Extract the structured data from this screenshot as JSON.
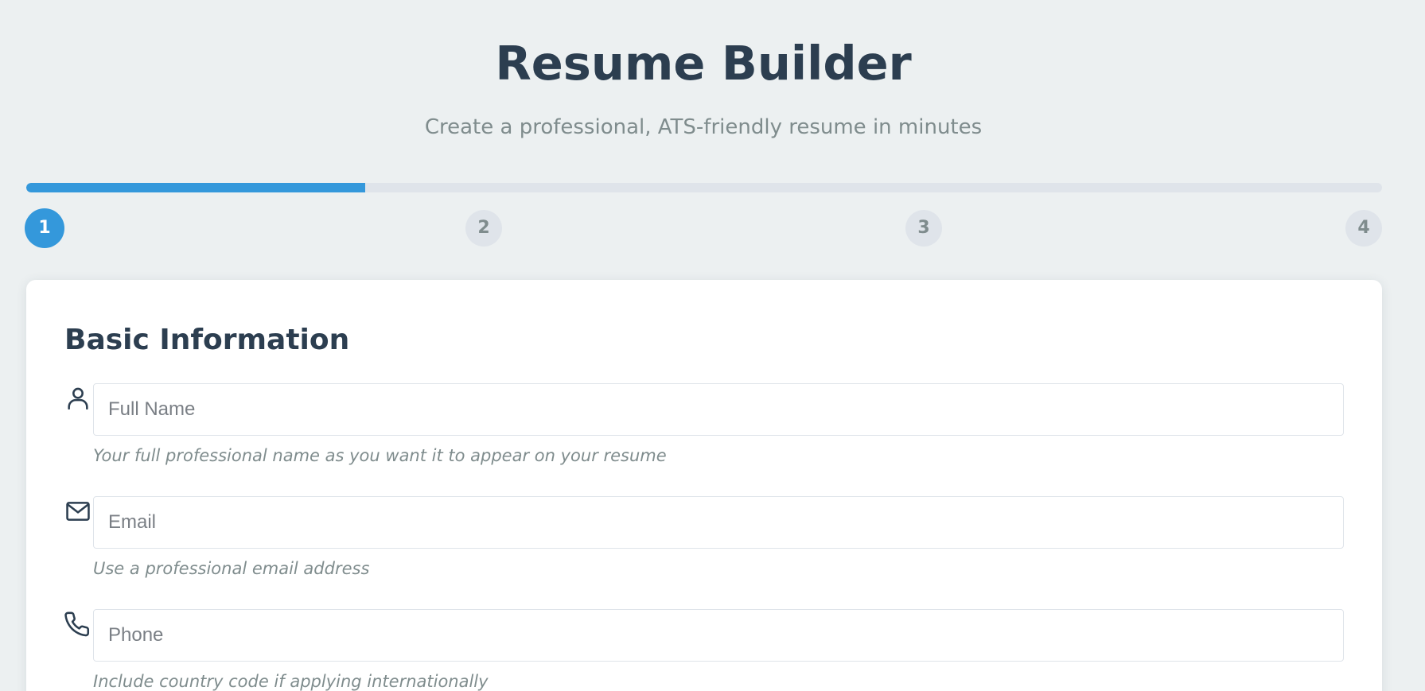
{
  "header": {
    "title": "Resume Builder",
    "subtitle": "Create a professional, ATS-friendly resume in minutes"
  },
  "progress": {
    "current_step": 1,
    "total_steps": 4,
    "fraction_complete": 0.25,
    "steps": [
      "1",
      "2",
      "3",
      "4"
    ]
  },
  "form": {
    "section_title": "Basic Information",
    "fields": [
      {
        "icon": "user-icon",
        "value": "",
        "placeholder": "Full Name",
        "hint": "Your full professional name as you want it to appear on your resume"
      },
      {
        "icon": "mail-icon",
        "value": "",
        "placeholder": "Email",
        "hint": "Use a professional email address"
      },
      {
        "icon": "phone-icon",
        "value": "",
        "placeholder": "Phone",
        "hint": "Include country code if applying internationally"
      }
    ]
  },
  "colors": {
    "accent": "#3498db",
    "heading": "#2c3e50",
    "muted": "#7f8c8d",
    "background": "#ecf0f1",
    "track": "#dfe4ea"
  }
}
